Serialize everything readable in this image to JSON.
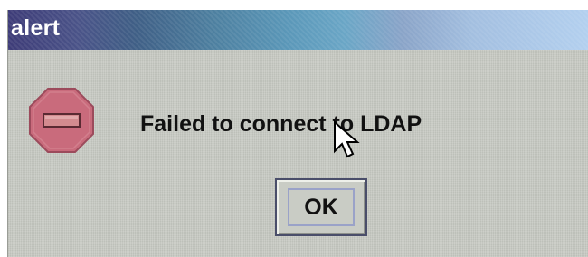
{
  "window": {
    "title": "alert"
  },
  "dialog": {
    "icon": "stop-icon",
    "message": "Failed to connect to LDAP",
    "ok_label": "OK"
  },
  "colors": {
    "dialog_background": "#c7cac3",
    "stop_icon_fill": "#c96b7c",
    "title_text": "#ffffff"
  }
}
